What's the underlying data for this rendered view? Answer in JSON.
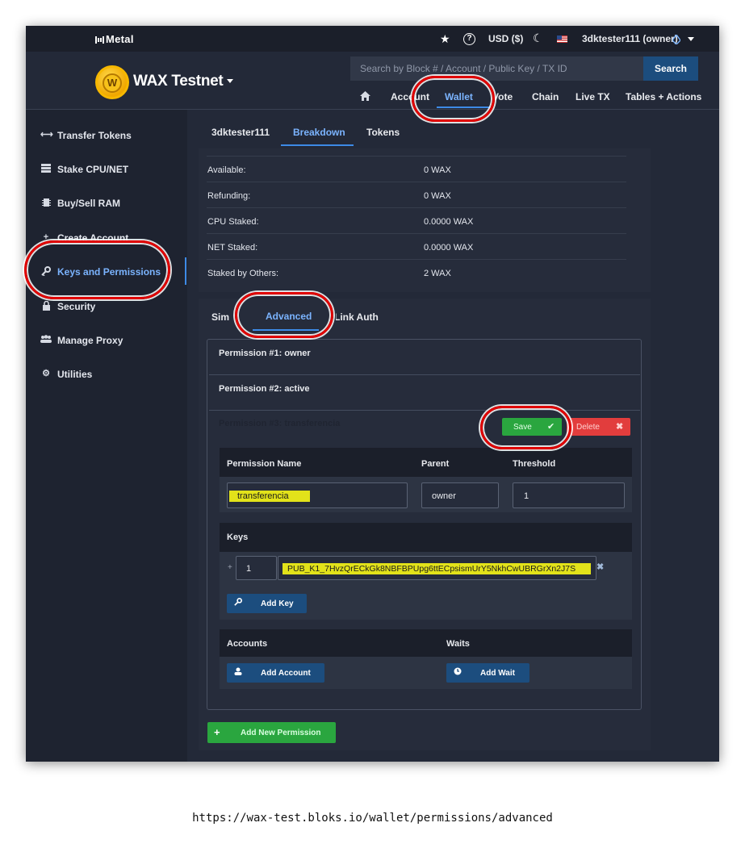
{
  "topbar": {
    "brand": "Metal",
    "brand_icon": "bars-icon",
    "currency": "USD ($)",
    "account": "3dktester111 (owner)"
  },
  "header": {
    "network": "WAX Testnet",
    "search_placeholder": "Search by Block # / Account / Public Key / TX ID",
    "search_button": "Search",
    "nav": [
      "Account",
      "Wallet",
      "Vote",
      "Chain",
      "Live TX",
      "Tables + Actions"
    ],
    "active_nav": "Wallet"
  },
  "sidebar": {
    "items": [
      {
        "label": "Transfer Tokens",
        "icon": "arrows-icon"
      },
      {
        "label": "Stake CPU/NET",
        "icon": "server-icon"
      },
      {
        "label": "Buy/Sell RAM",
        "icon": "chip-icon"
      },
      {
        "label": "Create Account",
        "icon": "user-plus-icon"
      },
      {
        "label": "Keys and Permissions",
        "icon": "key-icon"
      },
      {
        "label": "Security",
        "icon": "lock-icon"
      },
      {
        "label": "Manage Proxy",
        "icon": "users-icon"
      },
      {
        "label": "Utilities",
        "icon": "gear-icon"
      }
    ],
    "active": "Keys and Permissions"
  },
  "account_tabs": [
    "3dktester111",
    "Breakdown",
    "Tokens"
  ],
  "breakdown": [
    {
      "label": "Available:",
      "value": "0 WAX"
    },
    {
      "label": "Refunding:",
      "value": "0 WAX"
    },
    {
      "label": "CPU Staked:",
      "value": "0.0000 WAX"
    },
    {
      "label": "NET Staked:",
      "value": "0.0000 WAX"
    },
    {
      "label": "Staked by Others:",
      "value": "2 WAX"
    }
  ],
  "perm_tabs": [
    "Simple",
    "Advanced",
    "Link Auth"
  ],
  "permissions": {
    "p1": "Permission #1: owner",
    "p2": "Permission #2: active",
    "p3": "Permission #3: transferencia",
    "save": "Save",
    "delete": "Delete",
    "headers": {
      "name": "Permission Name",
      "parent": "Parent",
      "threshold": "Threshold"
    },
    "name_value": "transferencia",
    "parent_value": "owner",
    "threshold_value": "1",
    "keys_label": "Keys",
    "key_weight": "1",
    "key_value": "PUB_K1_7HvzQrECkGk8NBFBPUpg6ttECpsismUrY5NkhCwUBRGrXn2J7S",
    "add_key": "Add Key",
    "accounts_label": "Accounts",
    "waits_label": "Waits",
    "add_account": "Add Account",
    "add_wait": "Add Wait",
    "add_new": "Add New Permission"
  },
  "url": "https://wax-test.bloks.io/wallet/permissions/advanced",
  "colors": {
    "accent": "#3d8ae6",
    "annotation": "#e00000",
    "highlight": "#e2e21a",
    "save": "#2aa63f",
    "delete": "#e23d3d"
  }
}
